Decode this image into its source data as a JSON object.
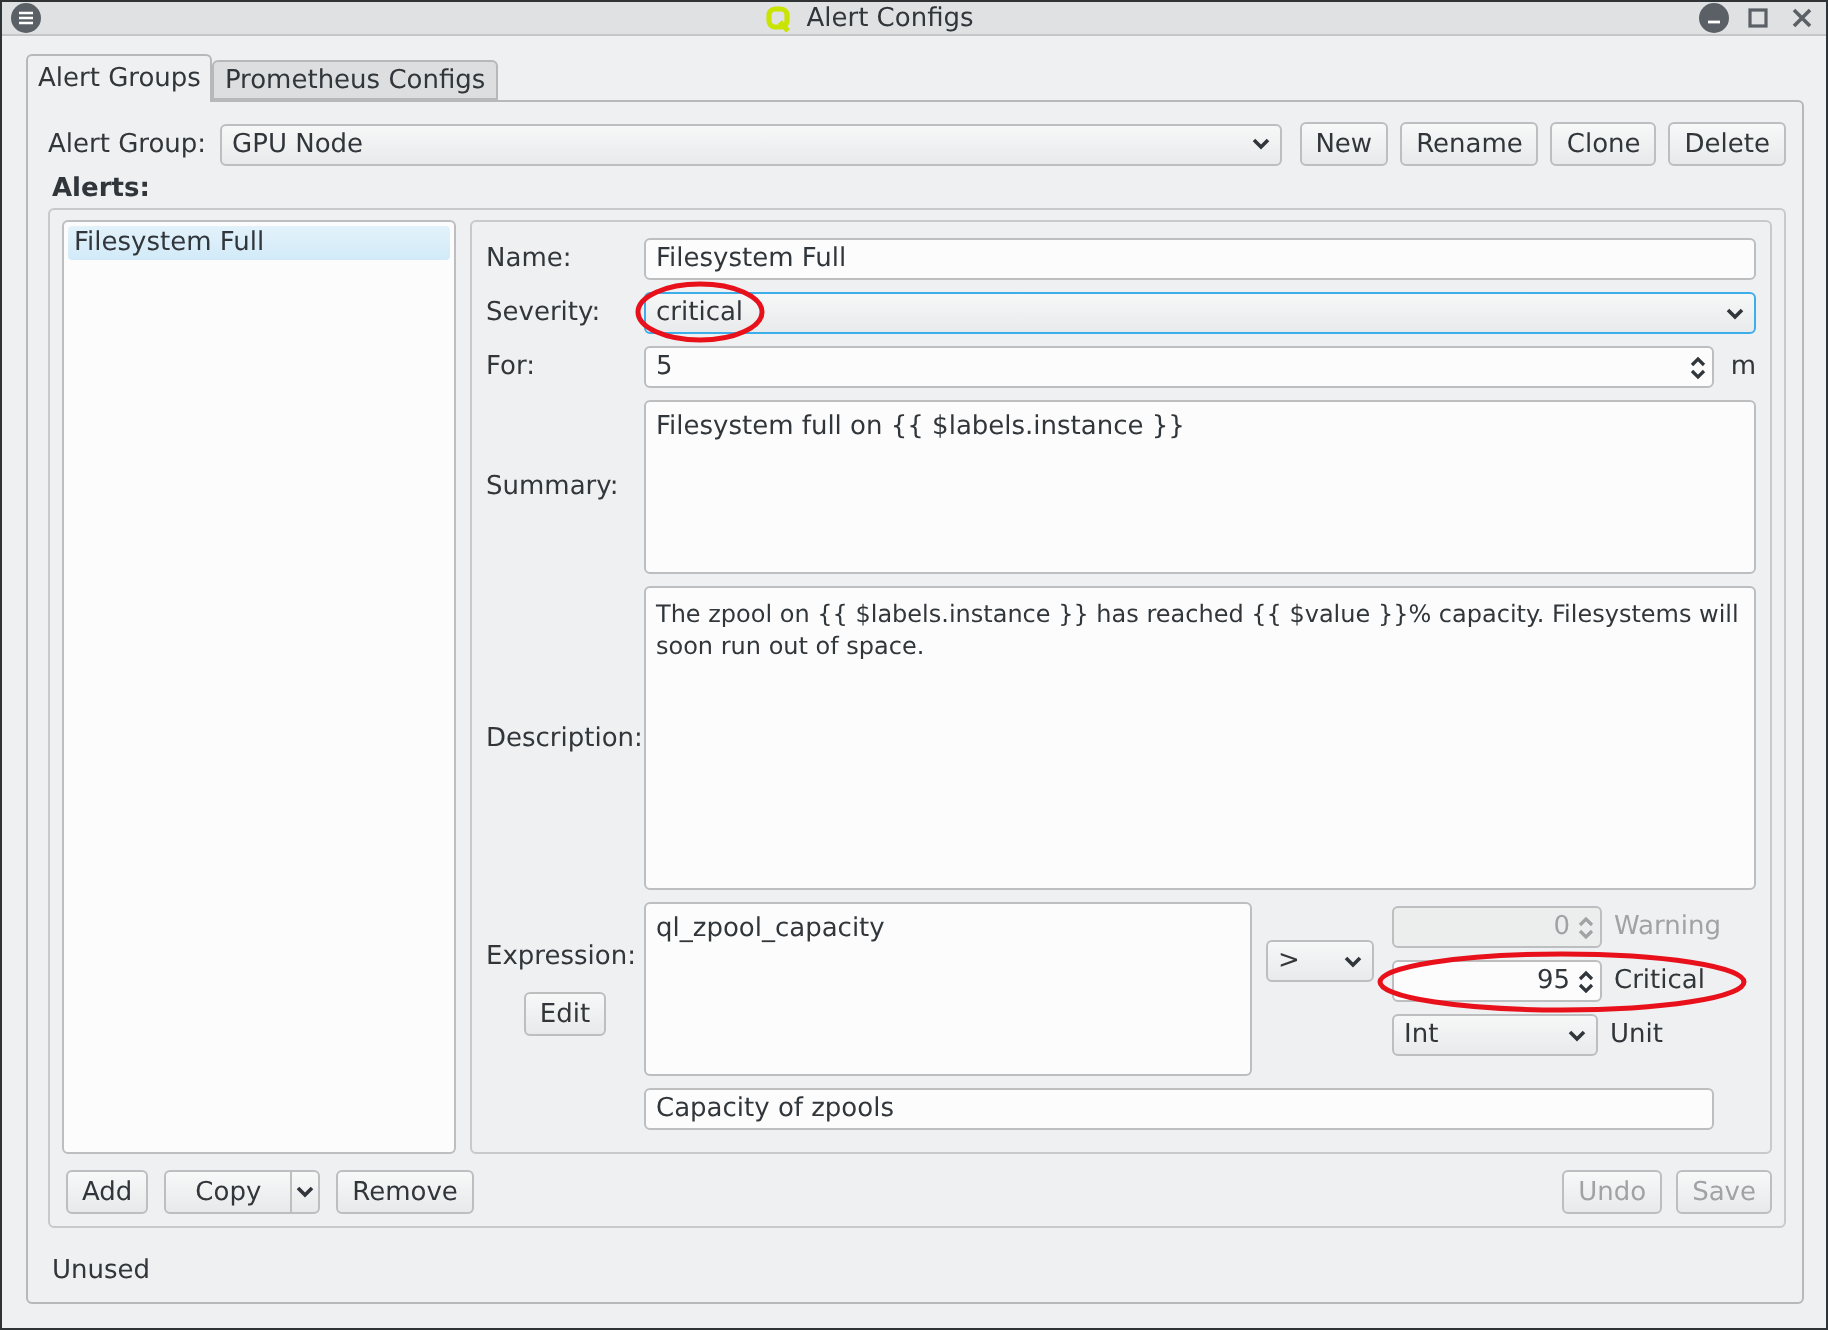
{
  "window": {
    "title": "Alert Configs"
  },
  "tabs": [
    {
      "label": "Alert Groups",
      "selected": true
    },
    {
      "label": "Prometheus Configs",
      "selected": false
    }
  ],
  "alert_group": {
    "label": "Alert Group:",
    "value": "GPU Node"
  },
  "group_buttons": [
    {
      "label": "New"
    },
    {
      "label": "Rename"
    },
    {
      "label": "Clone"
    },
    {
      "label": "Delete"
    }
  ],
  "alerts_label": "Alerts:",
  "alerts": [
    {
      "label": "Filesystem Full",
      "selected": true
    }
  ],
  "form": {
    "name_label": "Name:",
    "name": "Filesystem Full",
    "severity_label": "Severity:",
    "severity": {
      "value": "critical",
      "highlighted": true
    },
    "for_label": "For:",
    "for_value": "5",
    "for_unit": "m",
    "summary_label": "Summary:",
    "summary": "Filesystem full on {{ $labels.instance }}",
    "description_label": "Description:",
    "description": "The zpool on {{ $labels.instance }} has reached {{ $value }}% capacity. Filesystems will soon run out of space.",
    "expression_label": "Expression:",
    "edit_button": "Edit",
    "expression": "ql_zpool_capacity",
    "operator": ">",
    "thresholds": [
      {
        "value": "0",
        "label": "Warning",
        "disabled": true,
        "highlighted": false
      },
      {
        "value": "95",
        "label": "Critical",
        "disabled": false,
        "highlighted": true
      }
    ],
    "unit": {
      "value": "Int",
      "label": "Unit"
    },
    "expression_description": "Capacity of zpools"
  },
  "list_buttons": [
    {
      "label": "Add",
      "kind": "plain"
    },
    {
      "label": "Copy",
      "kind": "split"
    },
    {
      "label": "Remove",
      "kind": "plain"
    }
  ],
  "form_buttons": [
    {
      "label": "Undo",
      "disabled": true
    },
    {
      "label": "Save",
      "disabled": true
    }
  ],
  "status": "Unused"
}
